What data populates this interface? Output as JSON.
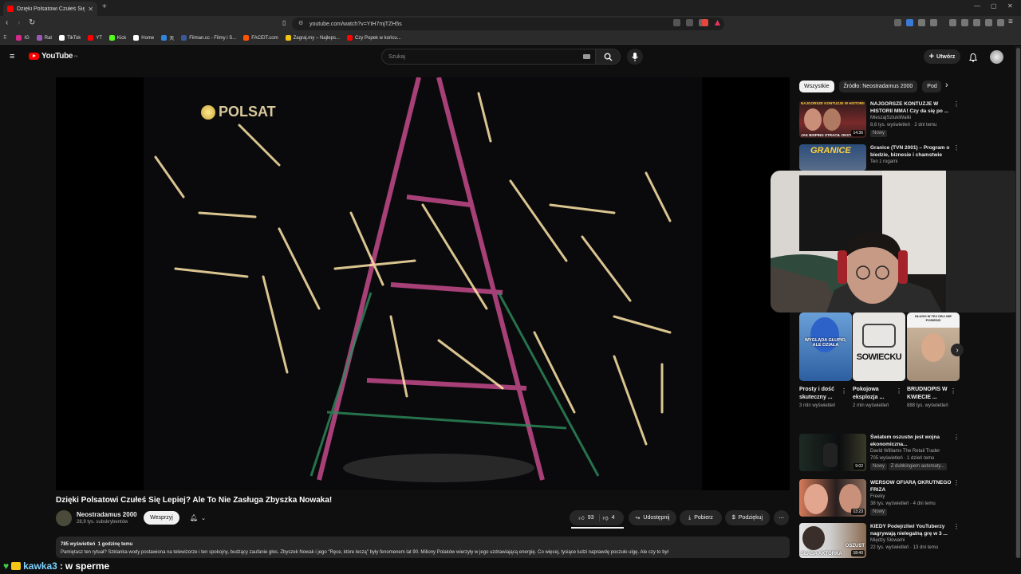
{
  "browser": {
    "tab_title": "Dzięki Polsatowi Czułeś Się Le",
    "new_tab": "+",
    "url": "youtube.com/watch?v=YtH7mjTZH5s",
    "window_controls": [
      "—",
      "▢",
      "✕"
    ],
    "bookmarks": [
      {
        "label": "IG",
        "color": "#d6298a"
      },
      {
        "label": "Rat",
        "color": "#9b59b6"
      },
      {
        "label": "TikTok",
        "color": "#ffffff"
      },
      {
        "label": "YT",
        "color": "#ff0000"
      },
      {
        "label": "Kick",
        "color": "#53fc18"
      },
      {
        "label": "Home",
        "color": "#ffffff"
      },
      {
        "label": "天",
        "color": "#2e86de"
      },
      {
        "label": "Filman.cc - Filmy i S...",
        "color": "#3b5998"
      },
      {
        "label": "FACEIT.com",
        "color": "#ff5500"
      },
      {
        "label": "Zagraj.my – Najleps...",
        "color": "#f1c40f"
      },
      {
        "label": "Czy Popek w końcu...",
        "color": "#ff0000"
      }
    ]
  },
  "youtube": {
    "logo_text": "YouTube",
    "logo_region": "PL",
    "search_placeholder": "Szukaj",
    "create_label": "Utwórz"
  },
  "player": {
    "watermark": "POLSAT"
  },
  "video": {
    "title": "Dzięki Polsatowi Czułeś Się Lepiej? Ale To Nie Zasługa Zbyszka Nowaka!",
    "channel": "Neostradamus 2000",
    "subscribers": "28,9 tys. subskrybentów",
    "support_label": "Wesprzyj",
    "likes": "93",
    "dislikes": "4",
    "share_label": "Udostępnij",
    "download_label": "Pobierz",
    "thanks_label": "Podziękuj",
    "views": "785 wyświetleń",
    "time": "1 godzinę temu",
    "description": "Pamiętasz ten rytuał? Szklanka wody postawiona na telewizorze i ten spokojny, budzący zaufanie głos. Zbyszek Nowak i jego \"Ręce, które leczą\" były fenomenem lat 90. Miliony Polaków wierzyły w jego uzdrawiającą energię. Co więcej, tysiące ludzi naprawdę poczuło ulgę. Ale czy to był"
  },
  "chips": [
    "Wszystkie",
    "Źródło: Neostradamus 2000",
    "Pod"
  ],
  "recommendations_top": [
    {
      "title": "NAJGORSZE KONTUZJE W HISTORII MMA! Czy da się po ...",
      "channel": "MieszajSztukiWalki",
      "meta": "8,6 tys. wyświetleń · 2 dni temu",
      "badge": "Nowy",
      "duration": "14:36",
      "thumb_caption": "JAK BISPING STRACIŁ OKO?",
      "thumb_header": "NAJGORSZE KONTUZJE W HISTORII"
    },
    {
      "title": "Granice (TVN 2001) – Program o biedzie, biznesie i chamstwie",
      "channel": "Ten z rogami",
      "thumb_header": "GRANICE"
    }
  ],
  "shorts": [
    {
      "title": "Prosty i dość skuteczny ...",
      "views": "3 mln wyświetleń",
      "caption": "WYGLĄDA GŁUPIO, ALE DZIAŁA"
    },
    {
      "title": "Pokojowa eksplozja ...",
      "views": "2 mln wyświetleń",
      "caption": "SOWIECKU"
    },
    {
      "title": "BRUDNOPIS W KWIECIE ...",
      "views": "888 tys. wyświetleń",
      "caption": "DŁUGO W TEJ CELI NIE POSIEDZI"
    }
  ],
  "recommendations_bottom": [
    {
      "title": "Światem oszustw jest wojna ekonomiczna...",
      "channel": "David Williams The Retail Trader",
      "meta": "705 wyświetleń · 1 dzień temu",
      "badge": "Nowy",
      "extra": "Z dubbingiem automaty...",
      "duration": "9:02"
    },
    {
      "title": "WERSOW OFIARĄ OKRUTNEGO FRIZA",
      "channel": "Freeky",
      "meta": "38 tys. wyświetleń · 4 dni temu",
      "badge": "Nowy",
      "duration": "13:23"
    },
    {
      "title": "KIEDY Podejrzliwi YouTuberzy nagrywają nielegalną grę w 3 ...",
      "channel": "Między Słowami",
      "meta": "22 tys. wyświetleń · 13 dni temu",
      "duration": "18:40",
      "thumb_caption": "SŁABA AKTORKA",
      "thumb_caption2": "OSZUST"
    }
  ],
  "chat": {
    "user": "kawka3",
    "separator": ":",
    "message": "w sperme"
  }
}
